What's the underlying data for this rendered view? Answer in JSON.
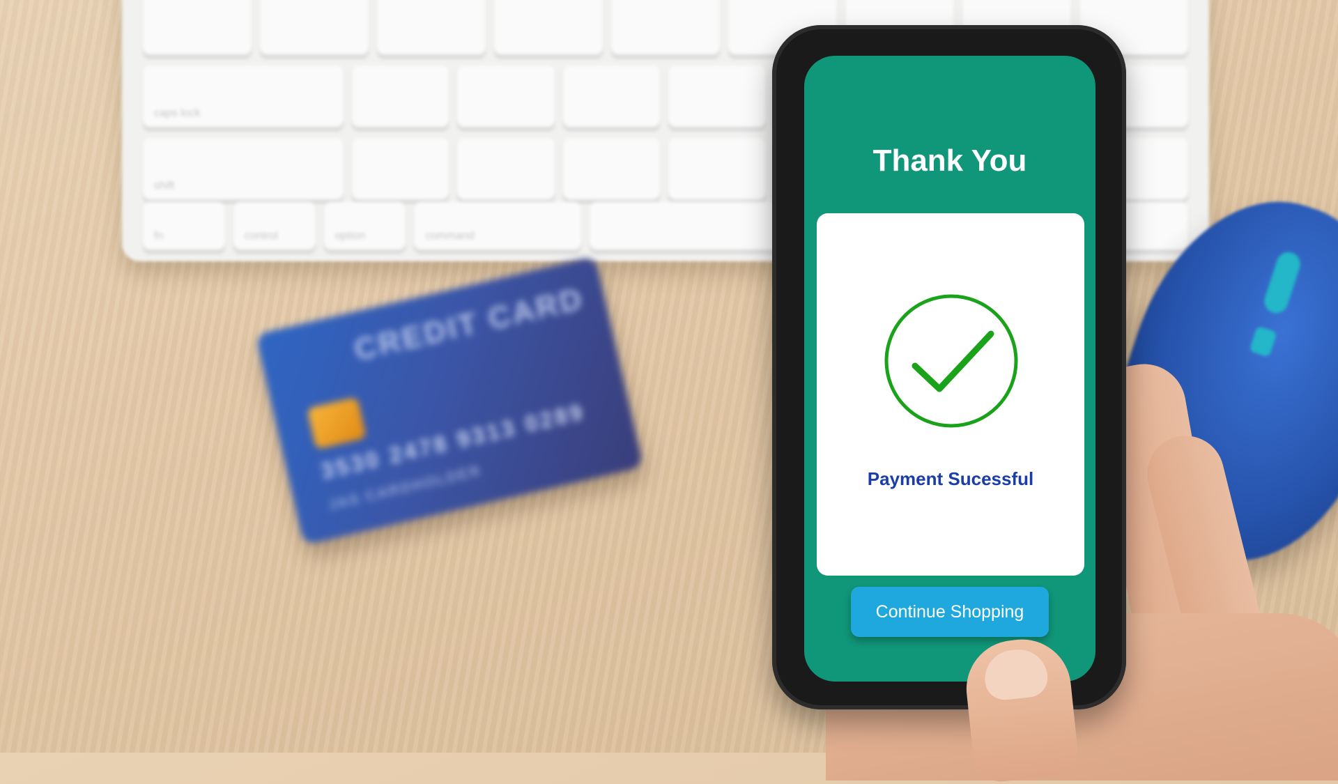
{
  "background": {
    "keyboard_keys": [
      "caps lock",
      "shift",
      "fn",
      "control",
      "option",
      "command"
    ],
    "credit_card": {
      "title": "CREDIT CARD",
      "number": "3530 2478 9313 0289",
      "holder": "JAS CARDHOLDER"
    }
  },
  "phone": {
    "screen": {
      "heading": "Thank You",
      "status_text": "Payment Sucessful",
      "status_icon": "check-circle-icon",
      "button_label": "Continue Shopping"
    },
    "colors": {
      "screen_bg": "#109678",
      "panel_bg": "#ffffff",
      "check_green": "#1aa21a",
      "status_text": "#1a3da8",
      "button_bg": "#1ea8dd"
    }
  }
}
